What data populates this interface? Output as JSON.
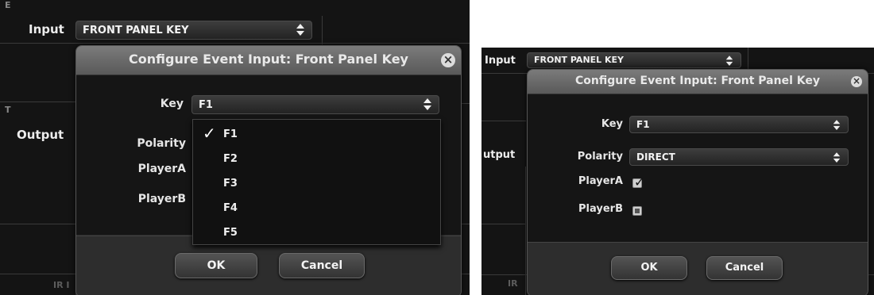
{
  "background": {
    "input_label": "Input",
    "output_label": "Output",
    "input_select_value": "FRONT PANEL KEY",
    "corner_letter_e": "E",
    "corner_letter_t": "T",
    "bottom_fragment": "IR I",
    "right_output_label": "utput",
    "right_bottom_fragment": "IR"
  },
  "left_dialog": {
    "title": "Configure Event Input: Front Panel Key",
    "close_icon": "×",
    "key_label": "Key",
    "key_value": "F1",
    "polarity_label": "Polarity",
    "player_a_label": "PlayerA",
    "player_b_label": "PlayerB",
    "ok_label": "OK",
    "cancel_label": "Cancel",
    "dropdown": {
      "check_mark": "✓",
      "options": [
        "F1",
        "F2",
        "F3",
        "F4",
        "F5"
      ],
      "selected": "F1"
    }
  },
  "right_dialog": {
    "title": "Configure Event Input: Front Panel Key",
    "close_icon": "×",
    "key_label": "Key",
    "key_value": "F1",
    "polarity_label": "Polarity",
    "polarity_value": "DIRECT",
    "player_a_label": "PlayerA",
    "player_a_checked": true,
    "player_a_mark": "✓",
    "player_b_label": "PlayerB",
    "player_b_checked": false,
    "ok_label": "OK",
    "cancel_label": "Cancel"
  }
}
